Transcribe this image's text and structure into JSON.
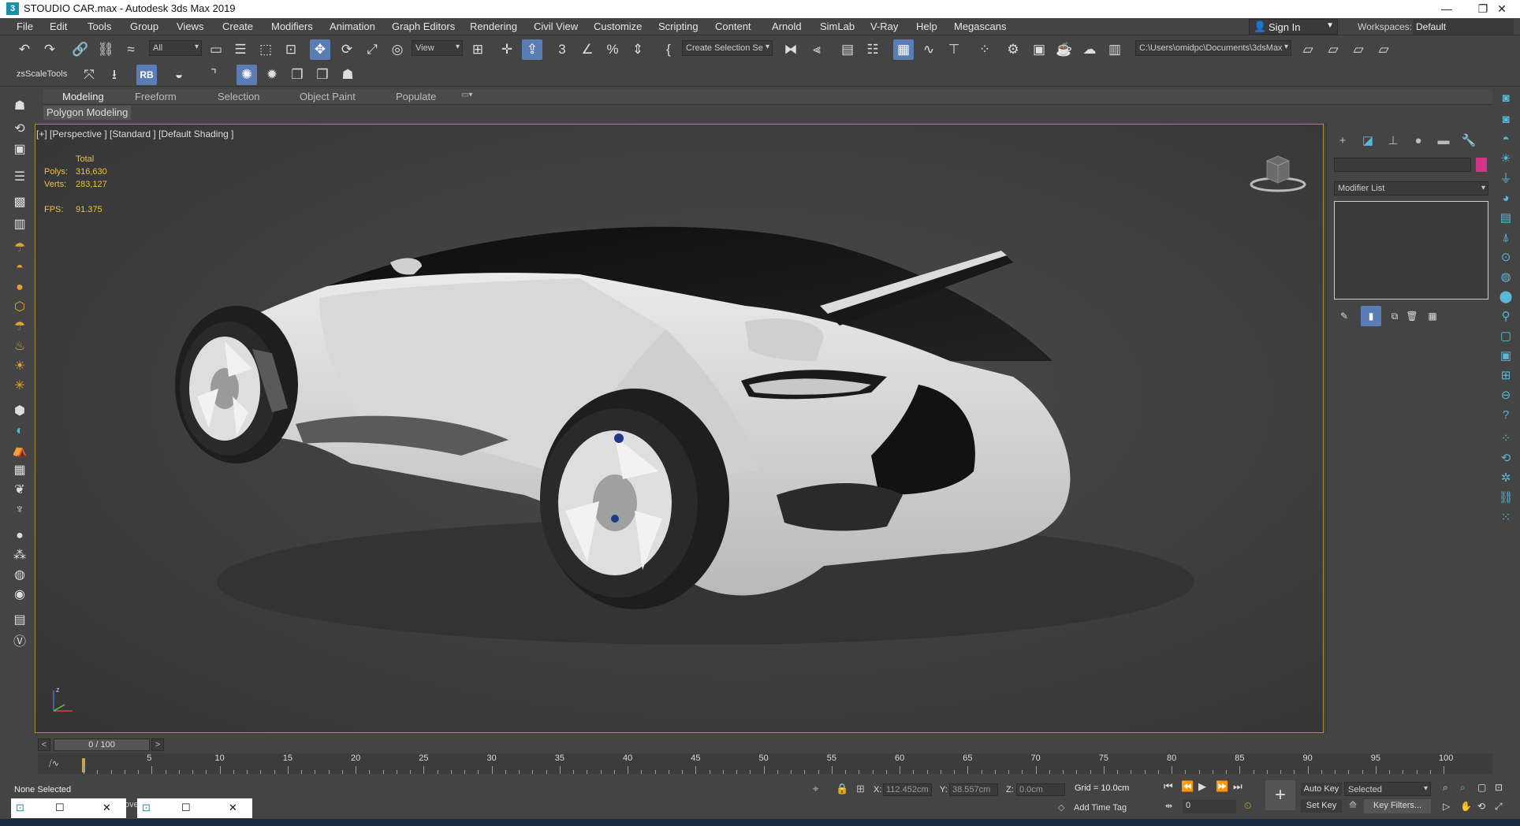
{
  "app": {
    "title": "STOUDIO  CAR.max - Autodesk 3ds Max 2019",
    "logo_letter": "3",
    "window_buttons": [
      "—",
      "❐",
      "✕"
    ]
  },
  "menu": [
    "File",
    "Edit",
    "Tools",
    "Group",
    "Views",
    "Create",
    "Modifiers",
    "Animation",
    "Graph Editors",
    "Rendering",
    "Civil View",
    "Customize",
    "Scripting",
    "Content",
    "Arnold",
    "SimLab",
    "V-Ray",
    "Help",
    "Megascans"
  ],
  "signin_label": "Sign In",
  "workspaces": {
    "label": "Workspaces:",
    "value": "Default"
  },
  "toolbar": {
    "selection_filter": "All",
    "ref_coord": "View",
    "create_selection_set": "Create Selection Se",
    "project_path": "C:\\Users\\omidpc\\Documents\\3dsMax"
  },
  "toolbar2": {
    "zsscale_label": "zsScaleTools",
    "rb_label": "RB"
  },
  "ribbon": {
    "tabs": [
      "Modeling",
      "Freeform",
      "Selection",
      "Object Paint",
      "Populate"
    ],
    "active": "Modeling",
    "subpanel": "Polygon Modeling"
  },
  "viewport": {
    "label": "[+] [Perspective ] [Standard ] [Default Shading ]",
    "stats_header": "Total",
    "polys_label": "Polys:",
    "polys": "316,630",
    "verts_label": "Verts:",
    "verts": "283,127",
    "fps_label": "FPS:",
    "fps": "91.375",
    "axis_label": "z"
  },
  "command_panel": {
    "modifier_list": "Modifier List",
    "object_color": "#d4338a"
  },
  "timeslider": {
    "position": "0 / 100",
    "prev": "<",
    "next": ">",
    "frame": 0,
    "end": 100
  },
  "trackbar": {
    "ticks": [
      5,
      10,
      15,
      20,
      25,
      30,
      35,
      40,
      45,
      50,
      55,
      60,
      65,
      70,
      75,
      80,
      85,
      90,
      95,
      100
    ]
  },
  "status": {
    "selection": "None Selected",
    "x_label": "X:",
    "x": "112.452cm",
    "y_label": "Y:",
    "y": "38.557cm",
    "z_label": "Z:",
    "z": "0.0cm",
    "grid": "Grid = 10.0cm",
    "add_time_tag": "Add Time Tag",
    "auto_key": "Auto Key",
    "set_key": "Set Key",
    "selected": "Selected",
    "key_filters": "Key Filters...",
    "current_frame": "0",
    "maxscript_hint": "ove"
  },
  "colors": {
    "accent": "#5b7db6",
    "viewport_border": "#b08a3c",
    "stats": "#e8c24a",
    "create_icons": "#e1a331"
  }
}
